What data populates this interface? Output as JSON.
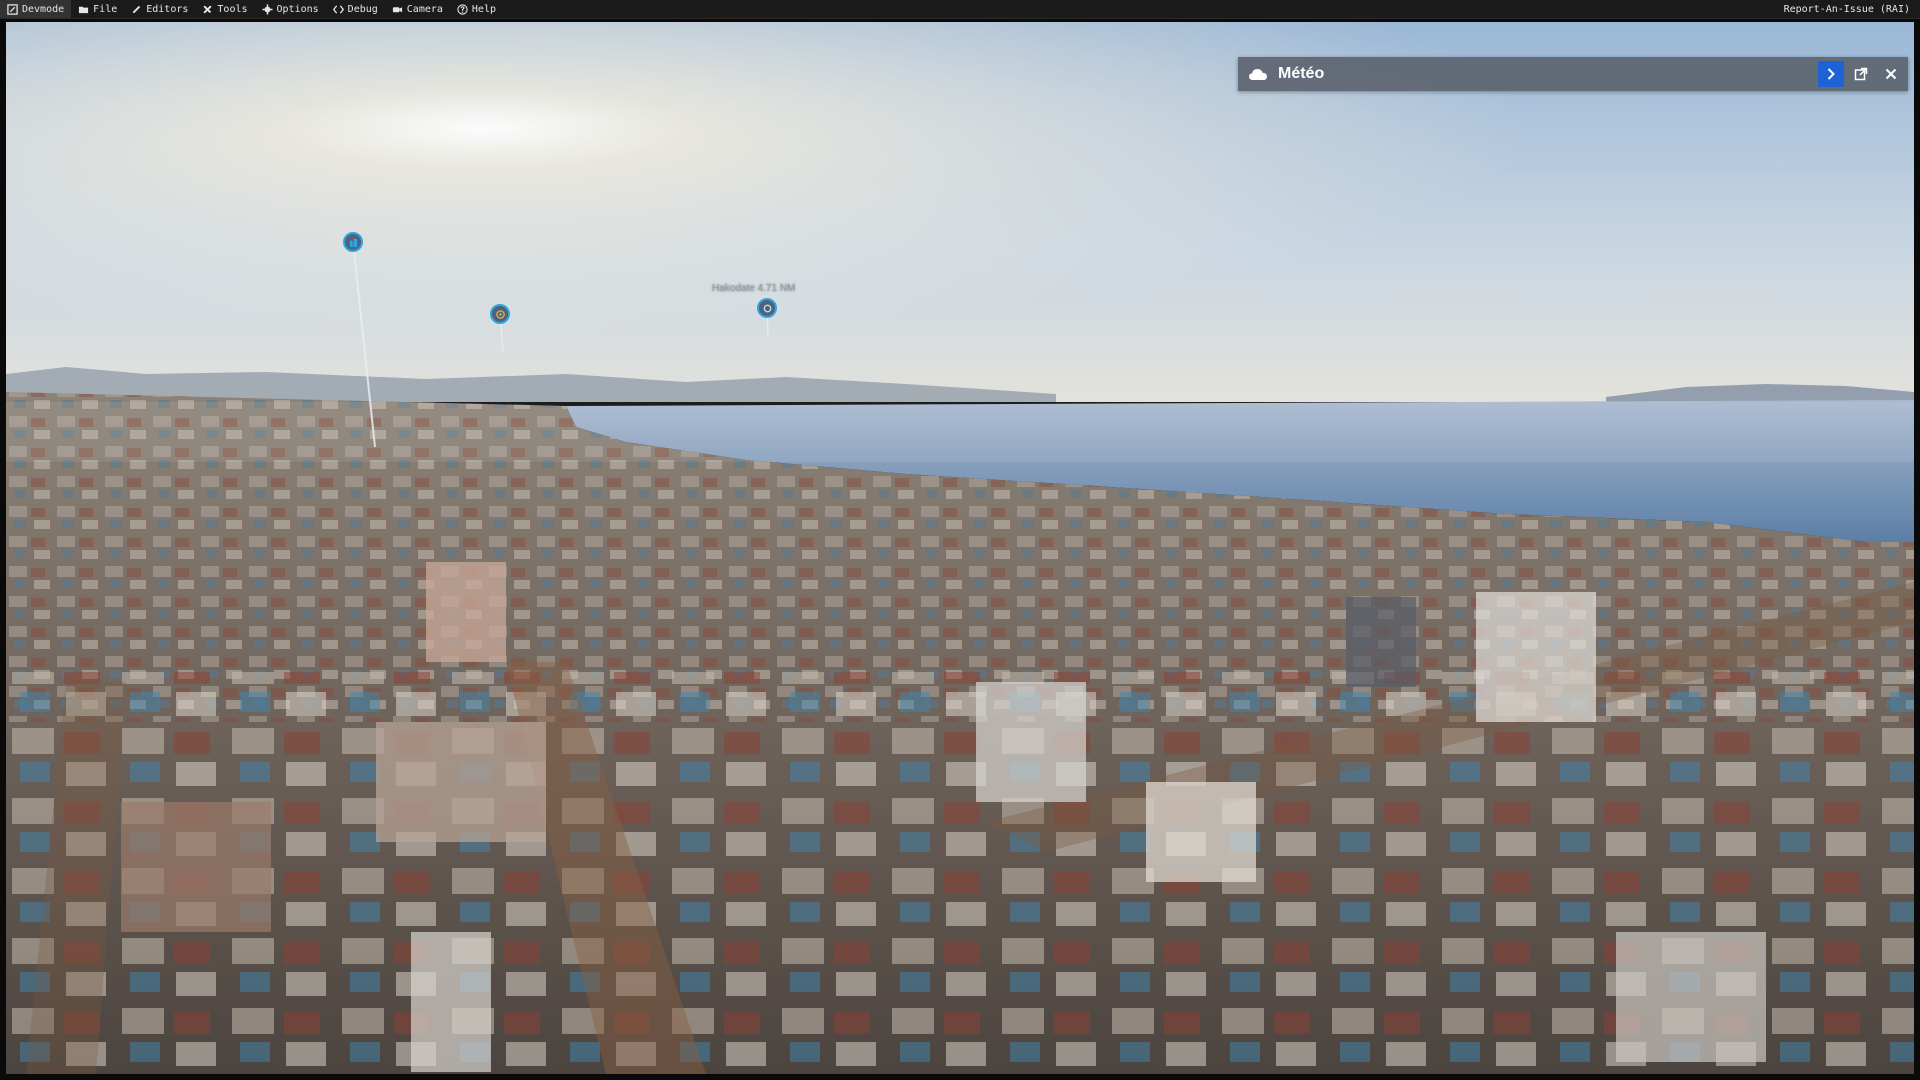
{
  "menubar": {
    "items": [
      {
        "label": "Devmode",
        "icon": "devmode-icon"
      },
      {
        "label": "File",
        "icon": "folder-icon"
      },
      {
        "label": "Editors",
        "icon": "pencil-icon"
      },
      {
        "label": "Tools",
        "icon": "tools-icon"
      },
      {
        "label": "Options",
        "icon": "gear-icon"
      },
      {
        "label": "Debug",
        "icon": "code-icon"
      },
      {
        "label": "Camera",
        "icon": "camera-icon"
      },
      {
        "label": "Help",
        "icon": "help-icon"
      }
    ],
    "right_label": "Report-An-Issue (RAI)"
  },
  "weather_panel": {
    "title": "Météo",
    "icon": "cloud-icon",
    "buttons": [
      "chevron-right-icon",
      "external-window-icon",
      "close-icon"
    ],
    "accent_color": "#1e63d6"
  },
  "pois": [
    {
      "icon": "building-icon"
    },
    {
      "icon": "airport-icon"
    },
    {
      "icon": "navaid-icon",
      "label": "Hakodate 4.71 NM"
    }
  ],
  "colors": {
    "poi_ring": "#2aa6e8",
    "menubar_bg": "#1b1b1b"
  }
}
